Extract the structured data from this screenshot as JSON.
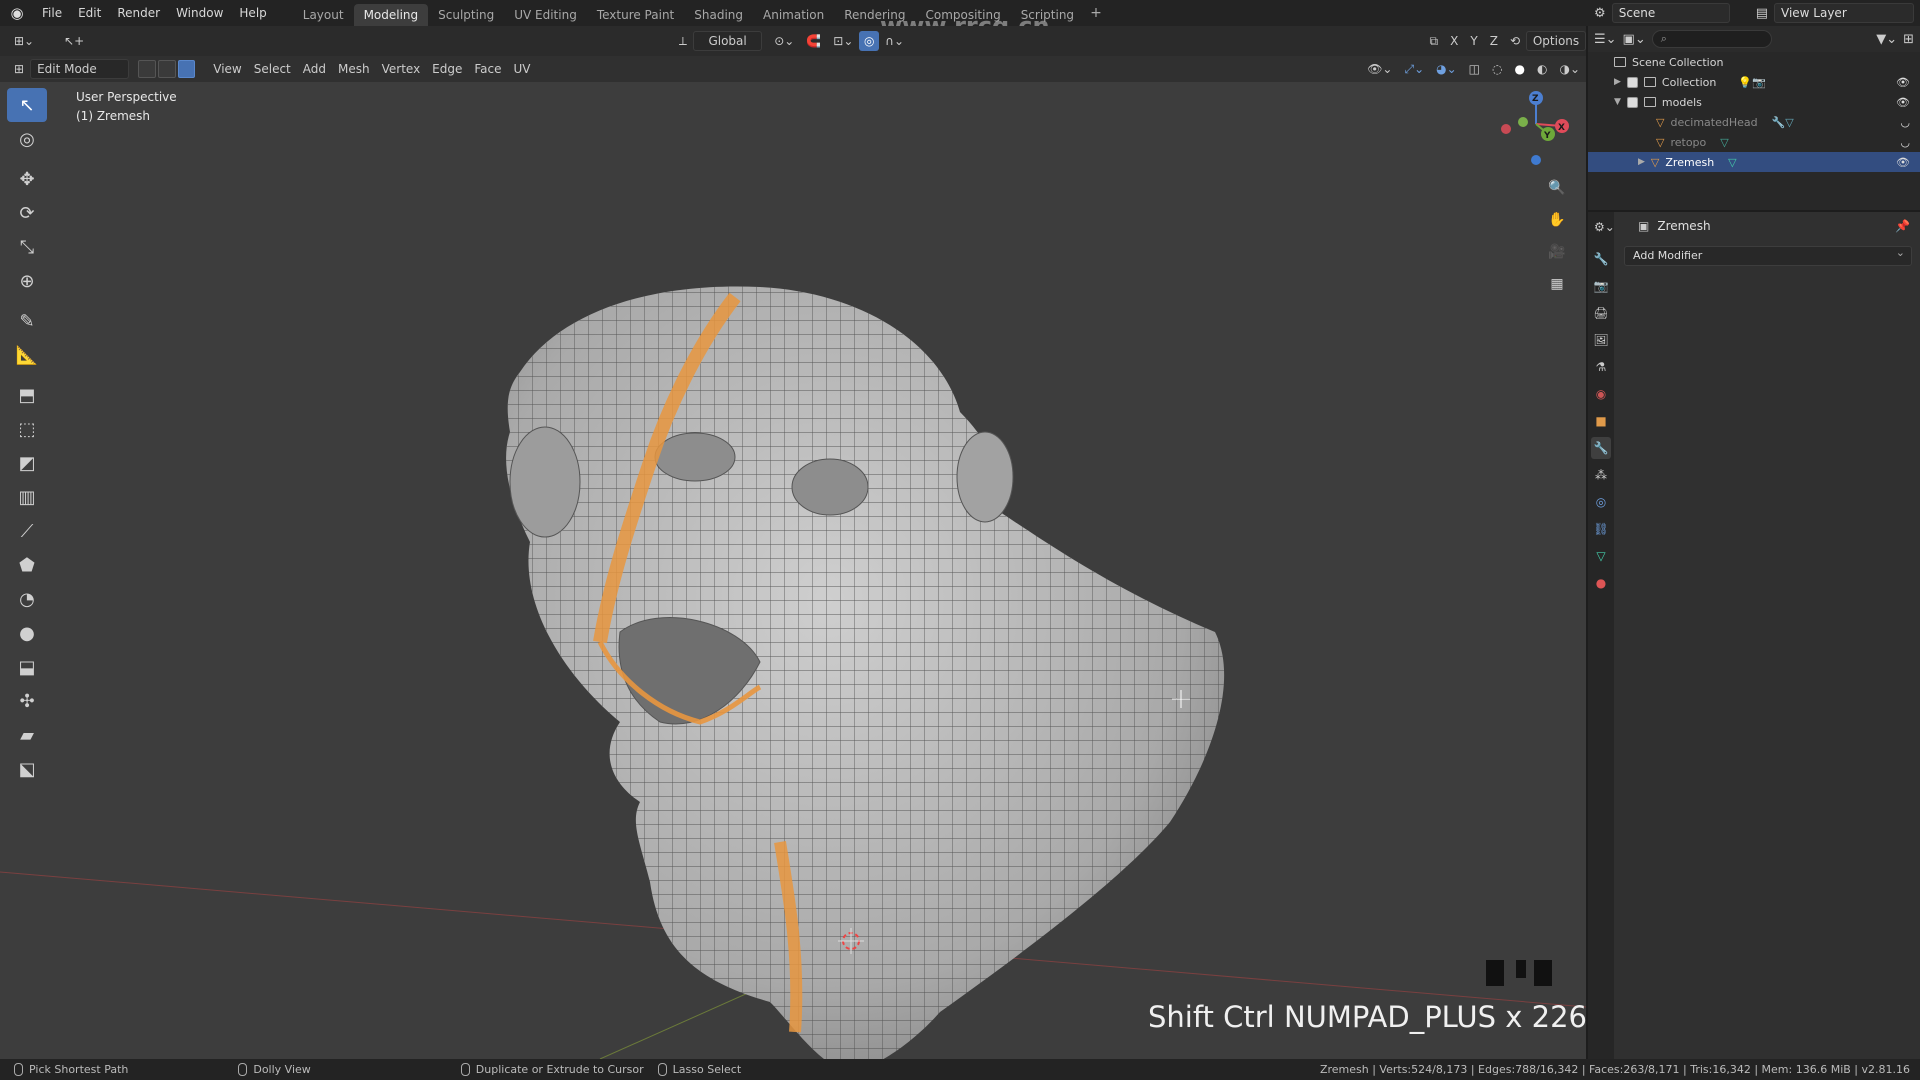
{
  "menu": {
    "items": [
      "File",
      "Edit",
      "Render",
      "Window",
      "Help"
    ],
    "workspaces": [
      "Layout",
      "Modeling",
      "Sculpting",
      "UV Editing",
      "Texture Paint",
      "Shading",
      "Animation",
      "Rendering",
      "Compositing",
      "Scripting"
    ],
    "active_workspace": "Modeling",
    "add_symbol": "+"
  },
  "topright": {
    "scene_label": "Scene",
    "view_layer_label": "View Layer"
  },
  "watermark": "www.rrcg.cn",
  "viewport_header": {
    "orientation": "Global",
    "options_label": "Options",
    "axes": [
      "X",
      "Y",
      "Z"
    ]
  },
  "editor_header": {
    "mode": "Edit Mode",
    "menus": [
      "View",
      "Select",
      "Add",
      "Mesh",
      "Vertex",
      "Edge",
      "Face",
      "UV"
    ]
  },
  "viewport": {
    "perspective_label": "User Perspective",
    "object_label": "(1) Zremesh",
    "keycast": "Shift Ctrl NUMPAD_PLUS x 226"
  },
  "outliner": {
    "root": "Scene Collection",
    "rows": [
      {
        "name": "Collection",
        "kind": "collection"
      },
      {
        "name": "models",
        "kind": "collection"
      },
      {
        "name": "decimatedHead",
        "kind": "mesh"
      },
      {
        "name": "retopo",
        "kind": "mesh"
      },
      {
        "name": "Zremesh",
        "kind": "mesh",
        "selected": true
      }
    ]
  },
  "properties": {
    "object_name": "Zremesh",
    "add_modifier_label": "Add Modifier"
  },
  "statusbar": {
    "left_hint": "Pick Shortest Path",
    "middle_hint": "Dolly View",
    "right_hint": "Duplicate or Extrude to Cursor",
    "lasso_hint": "Lasso Select",
    "stats": "Zremesh | Verts:524/8,173 | Edges:788/16,342 | Faces:263/8,171 | Tris:16,342 | Mem: 136.6 MiB | v2.81.16"
  },
  "colors": {
    "accent": "#4772b3",
    "seam": "#e8963f",
    "viewport_bg": "#3d3d3d",
    "mesh": "#b8b8b8"
  }
}
